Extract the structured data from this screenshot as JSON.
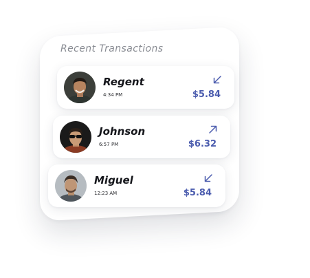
{
  "card": {
    "title": "Recent  Transactions"
  },
  "transactions": [
    {
      "name": "Regent",
      "time": "4:34 PM",
      "amount": "$5.84",
      "direction_icon": "arrow-down-left-icon"
    },
    {
      "name": "Johnson",
      "time": "6:57 PM",
      "amount": "$6.32",
      "direction_icon": "arrow-up-right-icon"
    },
    {
      "name": "Miguel",
      "time": "12:23 AM",
      "amount": "$5.84",
      "direction_icon": "arrow-down-left-icon"
    }
  ],
  "colors": {
    "accent": "#4b5cae",
    "title_gray": "#8a8d94",
    "name_text": "#16171c"
  }
}
